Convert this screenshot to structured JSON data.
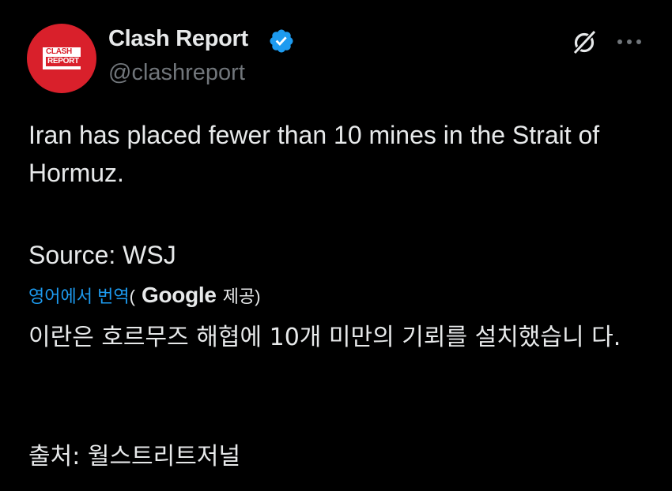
{
  "author": {
    "display_name": "Clash Report",
    "handle": "@clashreport",
    "avatar_line1": "CLASH",
    "avatar_line2": "REPORT",
    "verified_icon": "verified-badge-icon",
    "brand_color": "#d9202b",
    "verified_color": "#1d9bf0"
  },
  "actions": {
    "grok_icon": "grok-icon",
    "more_icon": "more-dots-icon"
  },
  "tweet": {
    "text": "Iran has placed fewer than 10 mines in the Strait of Hormuz.",
    "source": "Source: WSJ"
  },
  "translation": {
    "link_label": "영어에서 번역",
    "open_paren": "(",
    "provider": "Google",
    "provided_suffix": "제공)",
    "text": "이란은 호르무즈 해협에 10개 미만의 기뢰를 설치했습니 다.",
    "source": "출처: 월스트리트저널"
  },
  "colors": {
    "background": "#000000",
    "text": "#e7e9ea",
    "muted": "#71767b",
    "link": "#1d9bf0"
  }
}
